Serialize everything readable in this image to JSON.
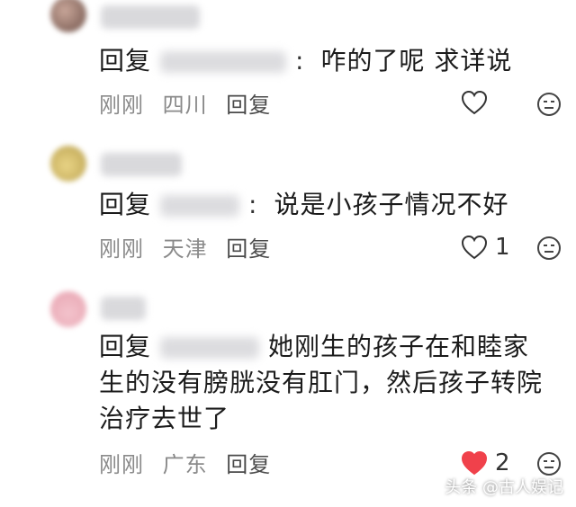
{
  "comments": [
    {
      "reply_prefix": "回复",
      "text": "咋的了呢 求详说",
      "time": "刚刚",
      "location": "四川",
      "reply_label": "回复",
      "like_count": "",
      "liked": false
    },
    {
      "reply_prefix": "回复",
      "text": "说是小孩子情况不好",
      "time": "刚刚",
      "location": "天津",
      "reply_label": "回复",
      "like_count": "1",
      "liked": false
    },
    {
      "reply_prefix": "回复",
      "text": "她刚生的孩子在和睦家生的没有膀胱没有肛门，然后孩子转院治疗去世了",
      "time": "刚刚",
      "location": "广东",
      "reply_label": "回复",
      "like_count": "2",
      "liked": true
    }
  ],
  "colors": {
    "like_active": "#f0414b",
    "meta_gray": "#8a8a8a"
  },
  "icons": {
    "like": "heart-icon",
    "emoji": "emoji-face-icon"
  },
  "watermark": "头条 @古人娱记"
}
